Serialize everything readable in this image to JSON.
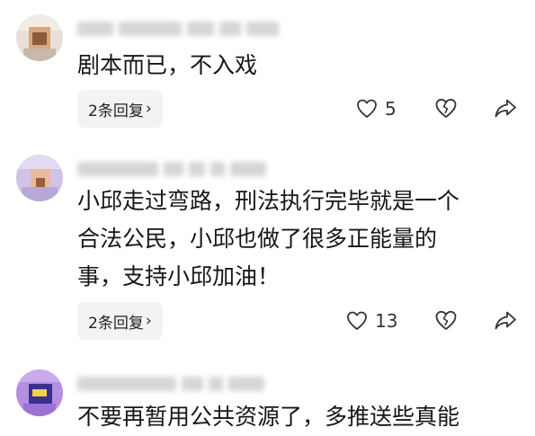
{
  "comments": [
    {
      "text": "剧本而已，不入戏",
      "reply_label": "2条回复",
      "like_count": "5"
    },
    {
      "text": "小邱走过弯路，刑法执行完毕就是一个\n合法公民，小邱也做了很多正能量的\n事，支持小邱加油！",
      "reply_label": "2条回复",
      "like_count": "13"
    },
    {
      "text": "不要再暂用公共资源了，多推送些真能"
    }
  ],
  "icons": {
    "reply_chevron": "chevron-right-icon",
    "like": "heart-icon",
    "dislike": "broken-heart-icon",
    "share": "share-icon"
  },
  "colors": {
    "background": "#ffffff",
    "reply_bg": "#f3f3f3",
    "icon_stroke": "#333333"
  }
}
